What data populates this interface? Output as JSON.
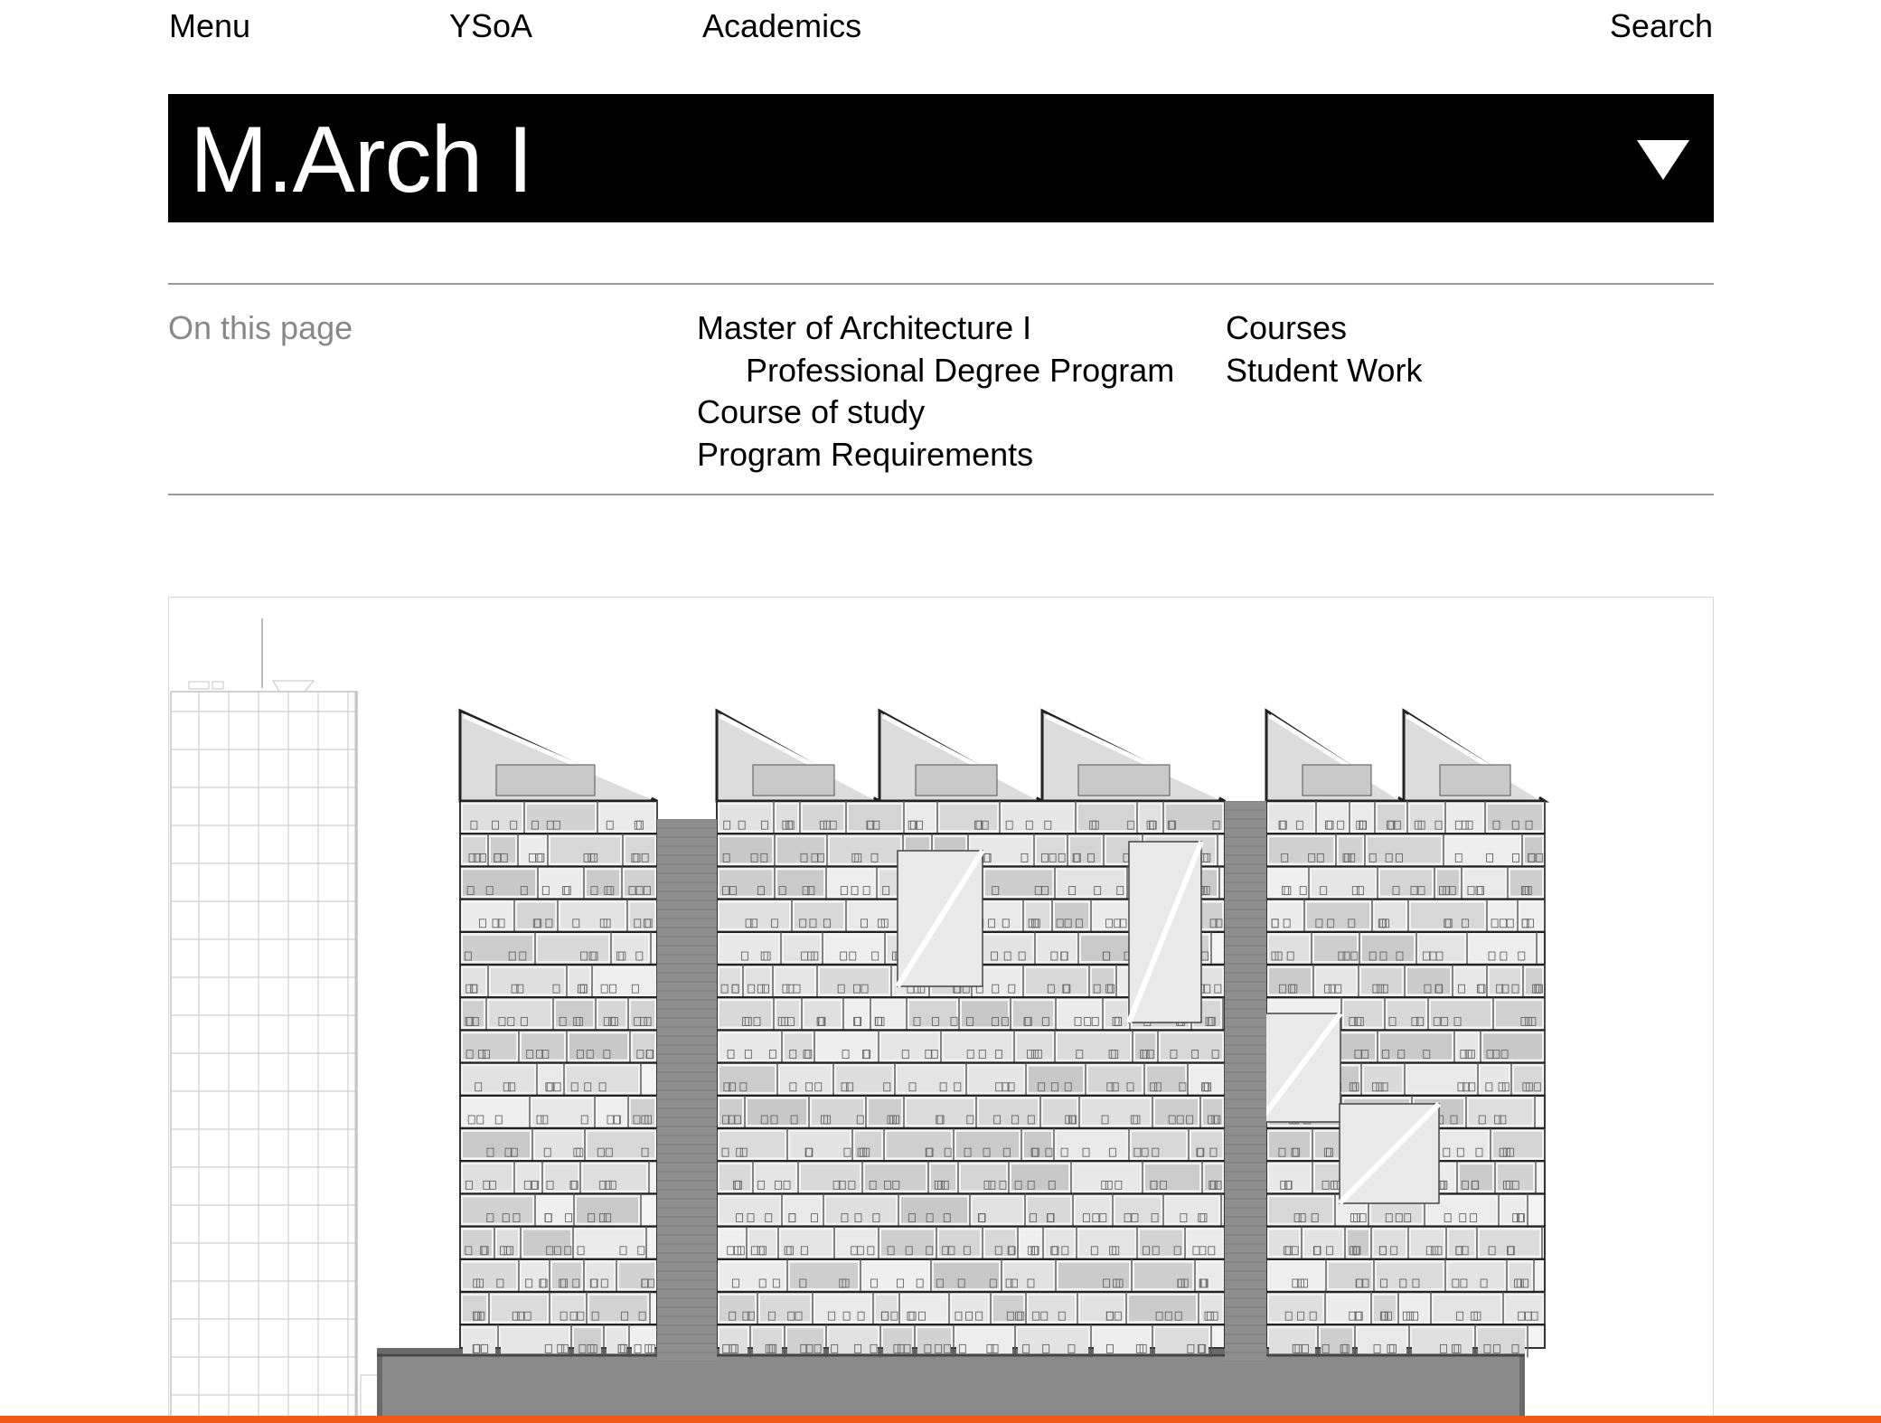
{
  "nav": {
    "menu": "Menu",
    "ysoa": "YSoA",
    "academics": "Academics",
    "search": "Search"
  },
  "page": {
    "title": "M.Arch I",
    "toggle_icon": "triangle-down-icon"
  },
  "on_this_page": {
    "label": "On this page",
    "col1": [
      "Master of Architecture I",
      "Professional Degree Program",
      "Course of study",
      "Program Requirements"
    ],
    "col2": [
      "Courses",
      "Student Work"
    ]
  },
  "figure": {
    "subject": "architectural-section-drawing"
  },
  "colors": {
    "title_bar": "#000000",
    "accent": "#f05a14",
    "muted_text": "#888888"
  }
}
